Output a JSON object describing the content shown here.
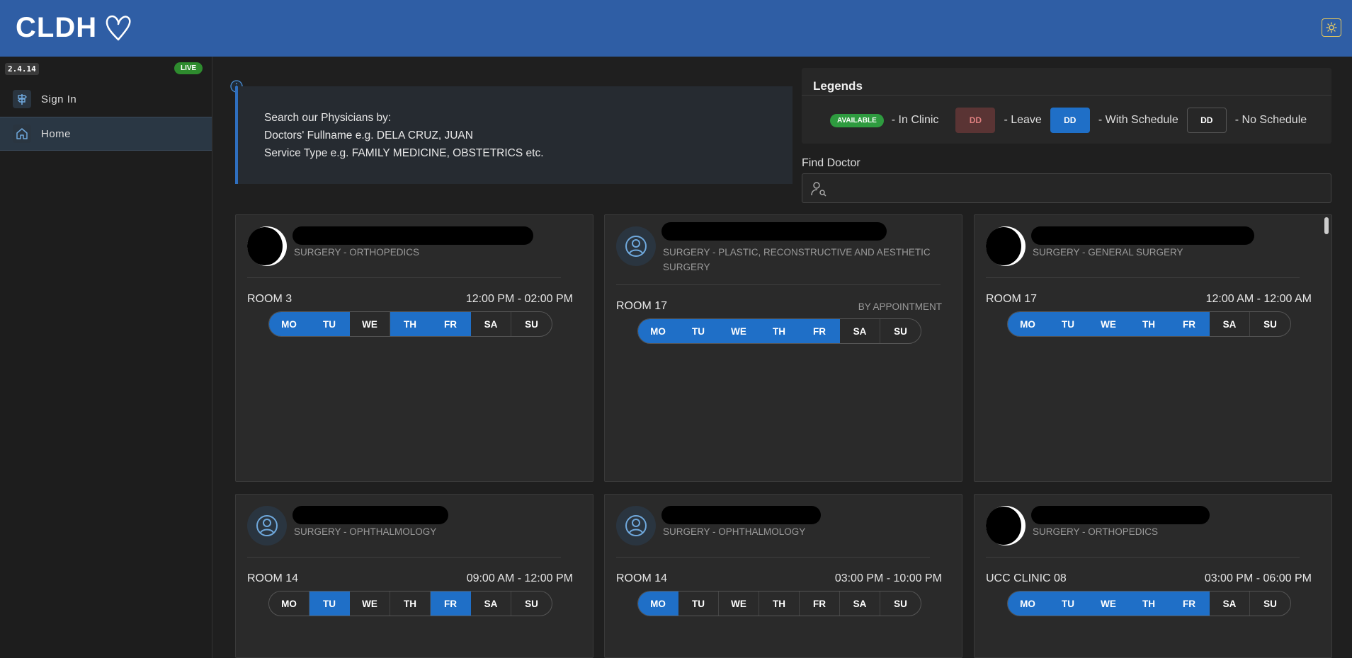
{
  "header": {
    "logo_text": "CLDH"
  },
  "sidebar": {
    "version": "2.4.14",
    "status_badge": "LIVE",
    "items": [
      {
        "label": "Sign In",
        "icon": "signpost-icon"
      },
      {
        "label": "Home",
        "icon": "home-icon"
      }
    ]
  },
  "info": {
    "line1": "Search our Physicians by:",
    "line2": "Doctors' Fullname e.g. DELA CRUZ, JUAN",
    "line3": "Service Type e.g. FAMILY MEDICINE, OBSTETRICS etc."
  },
  "legends": {
    "title": "Legends",
    "available_badge": "AVAILABLE",
    "in_clinic": "- In Clinic",
    "leave_code": "DD",
    "leave": "- Leave",
    "schedule_code": "DD",
    "with_schedule": "- With Schedule",
    "none_code": "DD",
    "no_schedule": "- No Schedule"
  },
  "search": {
    "label": "Find Doctor",
    "value": ""
  },
  "colors": {
    "header": "#2f5ea5",
    "accent": "#1f6fc7",
    "available": "#2e9b3f",
    "leave": "#5a3434"
  },
  "days": [
    "MO",
    "TU",
    "WE",
    "TH",
    "FR",
    "SA",
    "SU"
  ],
  "doctors": [
    {
      "specialty": "SURGERY - ORTHOPEDICS",
      "room": "ROOM 3",
      "time": "12:00 PM - 02:00 PM",
      "active": [
        1,
        1,
        0,
        1,
        1,
        0,
        0
      ]
    },
    {
      "specialty": "SURGERY - PLASTIC, RECONSTRUCTIVE AND AESTHETIC SURGERY",
      "room": "ROOM 17",
      "time": "BY APPOINTMENT",
      "active": [
        1,
        1,
        1,
        1,
        1,
        0,
        0
      ]
    },
    {
      "specialty": "SURGERY - GENERAL SURGERY",
      "room": "ROOM 17",
      "time": "12:00 AM - 12:00 AM",
      "active": [
        1,
        1,
        1,
        1,
        1,
        0,
        0
      ]
    },
    {
      "specialty": "SURGERY - OPHTHALMOLOGY",
      "room": "ROOM 14",
      "time": "09:00 AM - 12:00 PM",
      "active": [
        0,
        1,
        0,
        0,
        1,
        0,
        0
      ]
    },
    {
      "specialty": "SURGERY - OPHTHALMOLOGY",
      "room": "ROOM 14",
      "time": "03:00 PM - 10:00 PM",
      "active": [
        1,
        0,
        0,
        0,
        0,
        0,
        0
      ]
    },
    {
      "specialty": "SURGERY - ORTHOPEDICS",
      "room": "UCC CLINIC 08",
      "time": "03:00 PM - 06:00 PM",
      "active": [
        1,
        1,
        1,
        1,
        1,
        0,
        0
      ]
    }
  ]
}
